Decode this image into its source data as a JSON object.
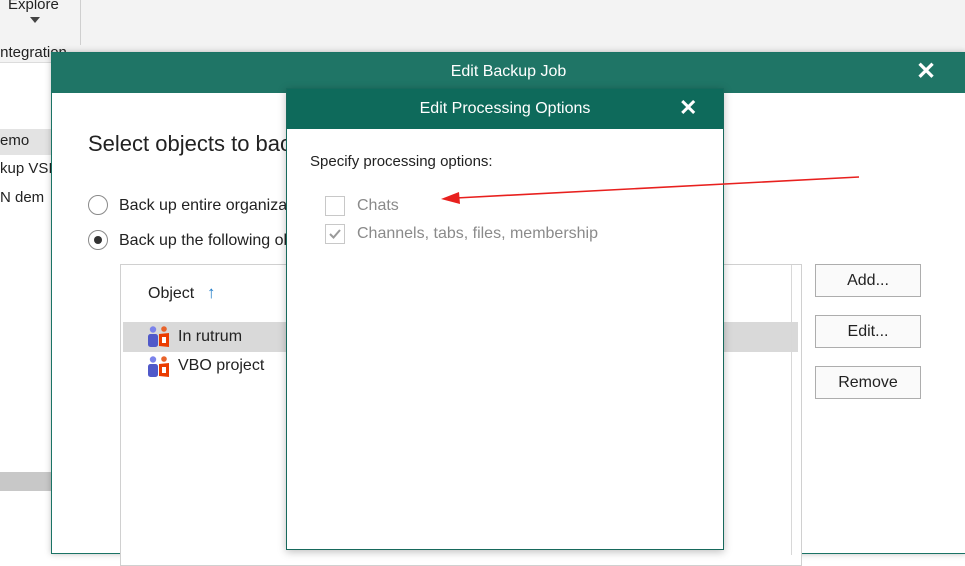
{
  "background": {
    "explore_label": "Explore",
    "integration_label": "Integration",
    "rows": [
      "emo",
      "kup VSI",
      "N dem"
    ],
    "right_dots": [
      "…",
      "…"
    ]
  },
  "main_window": {
    "title": "Edit Backup Job",
    "heading": "Select objects to back up",
    "radio_options": [
      {
        "label": "Back up entire organization",
        "selected": false
      },
      {
        "label": "Back up the following objects",
        "selected": true
      }
    ],
    "list": {
      "column_header": "Object",
      "sort_indicator": "↑",
      "rows": [
        {
          "label": "In rutrum",
          "icon": "teams-icon",
          "selected": true
        },
        {
          "label": "VBO project",
          "icon": "teams-icon",
          "selected": false
        }
      ]
    },
    "buttons": {
      "add": "Add...",
      "edit": "Edit...",
      "remove": "Remove"
    }
  },
  "dialog": {
    "title": "Edit Processing Options",
    "prompt": "Specify processing options:",
    "options": [
      {
        "label": "Chats",
        "checked": false,
        "enabled": false
      },
      {
        "label": "Channels, tabs, files, membership",
        "checked": true,
        "enabled": false
      }
    ]
  },
  "annotation": {
    "color": "#e8201e",
    "icon": "red-arrow"
  },
  "colors": {
    "title_bar": "#1f7566",
    "dialog_title_bar": "#0e6a5b",
    "sort_arrow": "#1d7ac7"
  }
}
